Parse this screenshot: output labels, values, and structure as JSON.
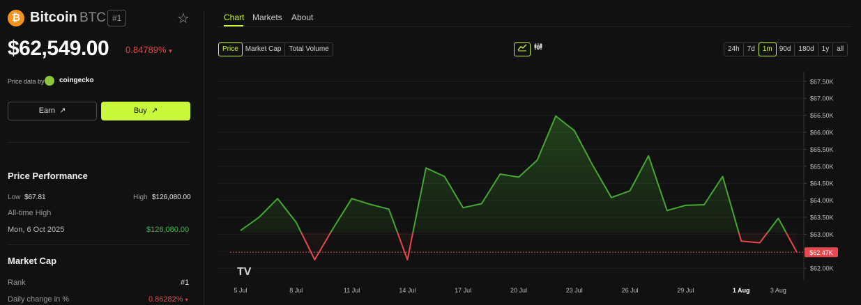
{
  "coin": {
    "icon": "bitcoin-icon",
    "icon_glyph": "₿",
    "name": "Bitcoin",
    "symbol": "BTC",
    "rank": "#1",
    "price": "$62,549.00",
    "change": "0.84789%",
    "change_arrow": "▾"
  },
  "price_data": {
    "label": "Price data by",
    "provider": "coingecko"
  },
  "actions": {
    "earn_label": "Earn",
    "buy_label": "Buy",
    "arrow": "↗"
  },
  "performance": {
    "title": "Price Performance",
    "low_label": "Low",
    "low_value": "$67.81",
    "high_label": "High",
    "high_value": "$126,080.00",
    "ath_label": "All-time High",
    "ath_date": "Mon, 6 Oct 2025",
    "ath_value": "$126,080.00"
  },
  "market_cap": {
    "title": "Market Cap",
    "rank_label": "Rank",
    "rank_value": "#1",
    "daily_label": "Daily change in %",
    "daily_value": "0.86282%",
    "daily_arrow": "▾"
  },
  "tabs": [
    {
      "label": "Chart",
      "active": true
    },
    {
      "label": "Markets",
      "active": false
    },
    {
      "label": "About",
      "active": false
    }
  ],
  "metric_toggle": [
    "Price",
    "Market Cap",
    "Total Volume"
  ],
  "metric_selected": "Price",
  "chart_type_toggle": [
    "line-chart-icon",
    "candlestick-icon"
  ],
  "ranges": [
    "24h",
    "7d",
    "1m",
    "90d",
    "180d",
    "1y",
    "all"
  ],
  "range_selected": "1m",
  "colors": {
    "accent": "#c9f73a",
    "up": "#46a832",
    "down": "#e5484d"
  },
  "chart_data": {
    "type": "line",
    "x": [
      "5 Jul",
      "6 Jul",
      "7 Jul",
      "8 Jul",
      "9 Jul",
      "10 Jul",
      "11 Jul",
      "12 Jul",
      "13 Jul",
      "14 Jul",
      "15 Jul",
      "16 Jul",
      "17 Jul",
      "18 Jul",
      "19 Jul",
      "20 Jul",
      "21 Jul",
      "22 Jul",
      "23 Jul",
      "24 Jul",
      "25 Jul",
      "26 Jul",
      "27 Jul",
      "28 Jul",
      "29 Jul",
      "30 Jul",
      "31 Jul",
      "1 Aug",
      "2 Aug",
      "3 Aug",
      "3 Aug end"
    ],
    "values": [
      63110,
      63500,
      64050,
      63350,
      62250,
      63180,
      64050,
      63880,
      63740,
      62250,
      64950,
      64700,
      63780,
      63900,
      64770,
      64680,
      65180,
      66480,
      66050,
      65020,
      64080,
      64280,
      65310,
      63700,
      63850,
      63870,
      64700,
      62800,
      62750,
      63470,
      62470
    ],
    "tick_labels": [
      "5 Jul",
      "8 Jul",
      "11 Jul",
      "14 Jul",
      "17 Jul",
      "20 Jul",
      "23 Jul",
      "26 Jul",
      "29 Jul",
      "1 Aug",
      "3 Aug"
    ],
    "y_ticks": [
      "$62.00K",
      "$62.50K",
      "$63.00K",
      "$63.50K",
      "$64.00K",
      "$64.50K",
      "$65.00K",
      "$65.50K",
      "$66.00K",
      "$66.50K",
      "$67.00K",
      "$67.50K"
    ],
    "ylim": [
      61800,
      67700
    ],
    "reference": 63050,
    "current_label": "$62.47K",
    "current_value": 62470,
    "watermark": "TV"
  }
}
